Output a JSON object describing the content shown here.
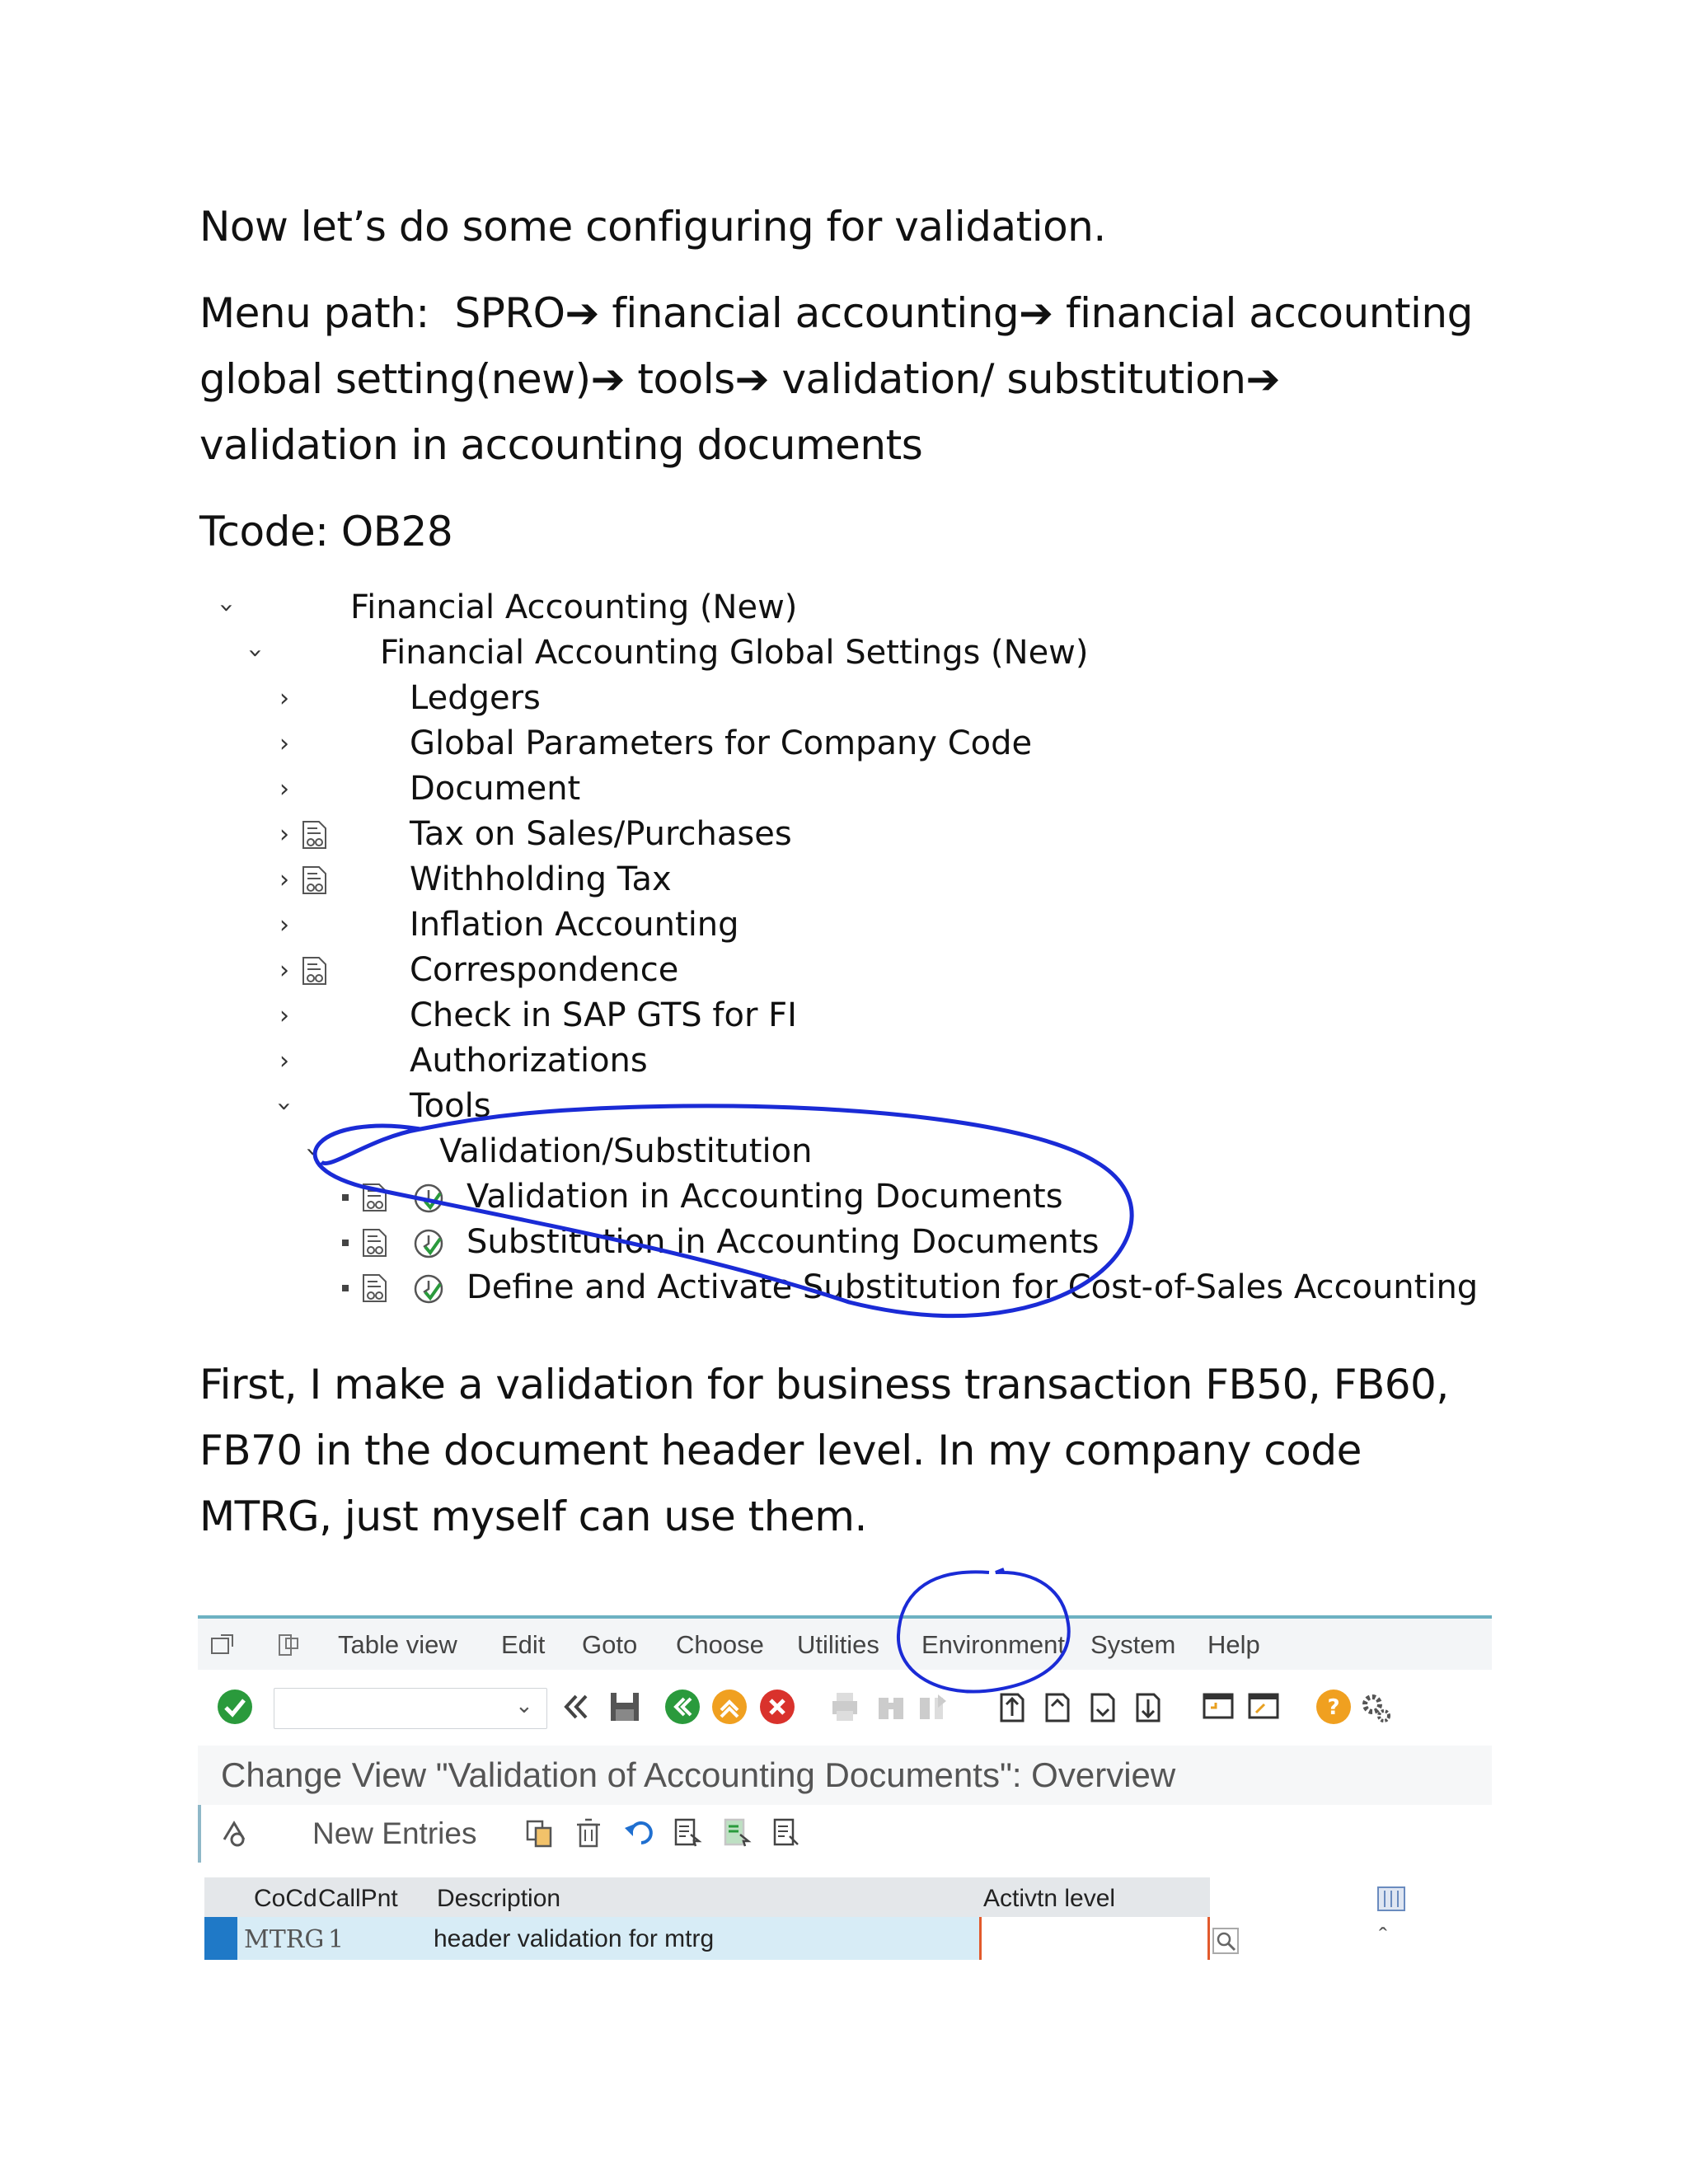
{
  "intro": "Now let’s do some configuring for validation.",
  "menu_path": {
    "label": "Menu path:",
    "steps": [
      "SPRO",
      "financial accounting",
      "financial accounting global setting(new)",
      "tools",
      "validation/ substitution",
      "validation in accounting documents"
    ],
    "arrow": "➔"
  },
  "tcode": "Tcode: OB28",
  "tree": {
    "items": [
      {
        "label": "Financial Accounting (New)",
        "state": "expanded"
      },
      {
        "label": "Financial Accounting Global Settings (New)",
        "state": "expanded"
      },
      {
        "label": "Ledgers",
        "state": "collapsed"
      },
      {
        "label": "Global Parameters for Company Code",
        "state": "collapsed"
      },
      {
        "label": "Document",
        "state": "collapsed"
      },
      {
        "label": "Tax on Sales/Purchases",
        "state": "collapsed",
        "icon": "document-icon"
      },
      {
        "label": "Withholding Tax",
        "state": "collapsed",
        "icon": "document-icon"
      },
      {
        "label": "Inflation Accounting",
        "state": "collapsed"
      },
      {
        "label": "Correspondence",
        "state": "collapsed",
        "icon": "document-icon"
      },
      {
        "label": "Check in SAP GTS for FI",
        "state": "collapsed"
      },
      {
        "label": "Authorizations",
        "state": "collapsed"
      },
      {
        "label": "Tools",
        "state": "expanded"
      },
      {
        "label": "Validation/Substitution",
        "state": "expanded"
      },
      {
        "label": "Validation in Accounting Documents",
        "state": "leaf",
        "icon": "execute-clock-icon"
      },
      {
        "label": "Substitution in Accounting Documents",
        "state": "leaf",
        "icon": "execute-clock-icon"
      },
      {
        "label": "Define and Activate Substitution for Cost-of-Sales Accounting",
        "state": "leaf",
        "icon": "execute-clock-icon"
      }
    ],
    "highlight_color": "#1a2bd6"
  },
  "paragraph2": [
    "First, I make a validation for business transaction FB50, FB60,",
    "FB70 in the document header level. In my company code",
    "MTRG, just myself can use them."
  ],
  "sap": {
    "menu": [
      "Table view",
      "Edit",
      "Goto",
      "Choose",
      "Utilities",
      "Environment",
      "System",
      "Help"
    ],
    "highlighted_menu": "Environment",
    "title": "Change View \"Validation of Accounting Documents\": Overview",
    "new_entries": "New Entries",
    "columns": [
      "CoCd",
      "CallPnt",
      "Description",
      "Activtn level"
    ],
    "rows": [
      {
        "cocd": "MTRG",
        "callpnt": "1",
        "description": "header validation for mtrg",
        "activation_level": ""
      }
    ],
    "colors": {
      "accent_line": "#6db1c2",
      "row_highlight": "#d7ecf6",
      "selector": "#1f79c7"
    }
  }
}
